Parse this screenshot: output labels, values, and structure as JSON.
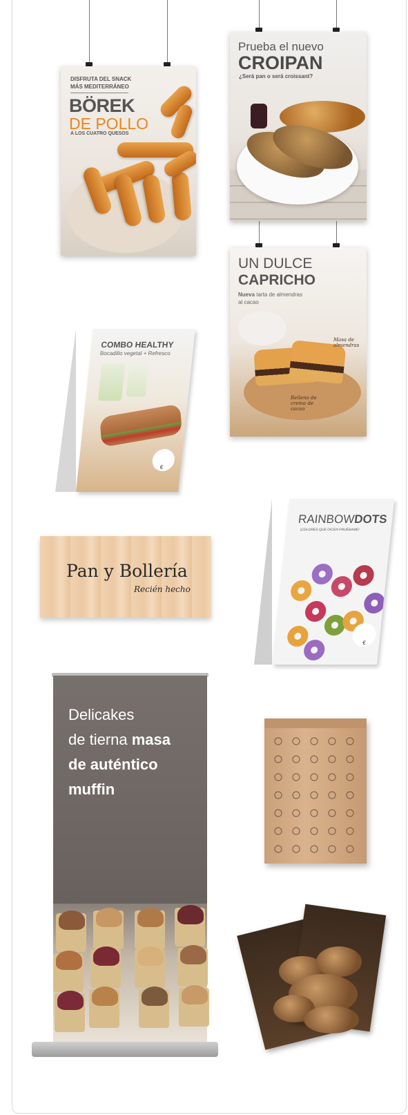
{
  "poster_borek": {
    "kicker_1": "DISFRUTA DEL SNACK",
    "kicker_2": "MÁS MEDITERRÁNEO",
    "title_1": "BÖREK",
    "title_2": "DE POLLO",
    "subtitle": "A LOS CUATRO QUESOS"
  },
  "poster_croipan": {
    "line_1": "Prueba el nuevo",
    "title": "CROIPAN",
    "subtitle": "¿Será pan o será croissant?"
  },
  "poster_capricho": {
    "title_1": "UN DULCE",
    "title_2": "CAPRICHO",
    "subtitle_bold": "Nueva",
    "subtitle_rest": " tarta de almendras",
    "subtitle_2": "al cacao",
    "note_1": "Masa de almendras",
    "note_2": "Relleno de crema de cacao"
  },
  "tent_combo": {
    "title": "COMBO HEALTHY",
    "subtitle": "Bocadillo vegetal + Refresco",
    "price_symbol": "€"
  },
  "sign_bolleria": {
    "title": "Pan y Bollería",
    "subtitle": "Recién hecho"
  },
  "tent_rainbow": {
    "brand_1": "RAINBOW",
    "brand_2": "DOTS",
    "tagline": "¡COLORES QUE DICEN PRUÉBAME!",
    "price_symbol": "€"
  },
  "rollup_banner": {
    "line_1": "Delicakes",
    "line_2_regular": "de tierna ",
    "line_2_bold": "masa",
    "line_3": "de auténtico",
    "line_4": "muffin"
  },
  "colors": {
    "croipan_title": "#4a4a4a",
    "borek_orange": "#e8861e",
    "banner_gray": "#6e6764",
    "kraft": "#d3ab84"
  }
}
